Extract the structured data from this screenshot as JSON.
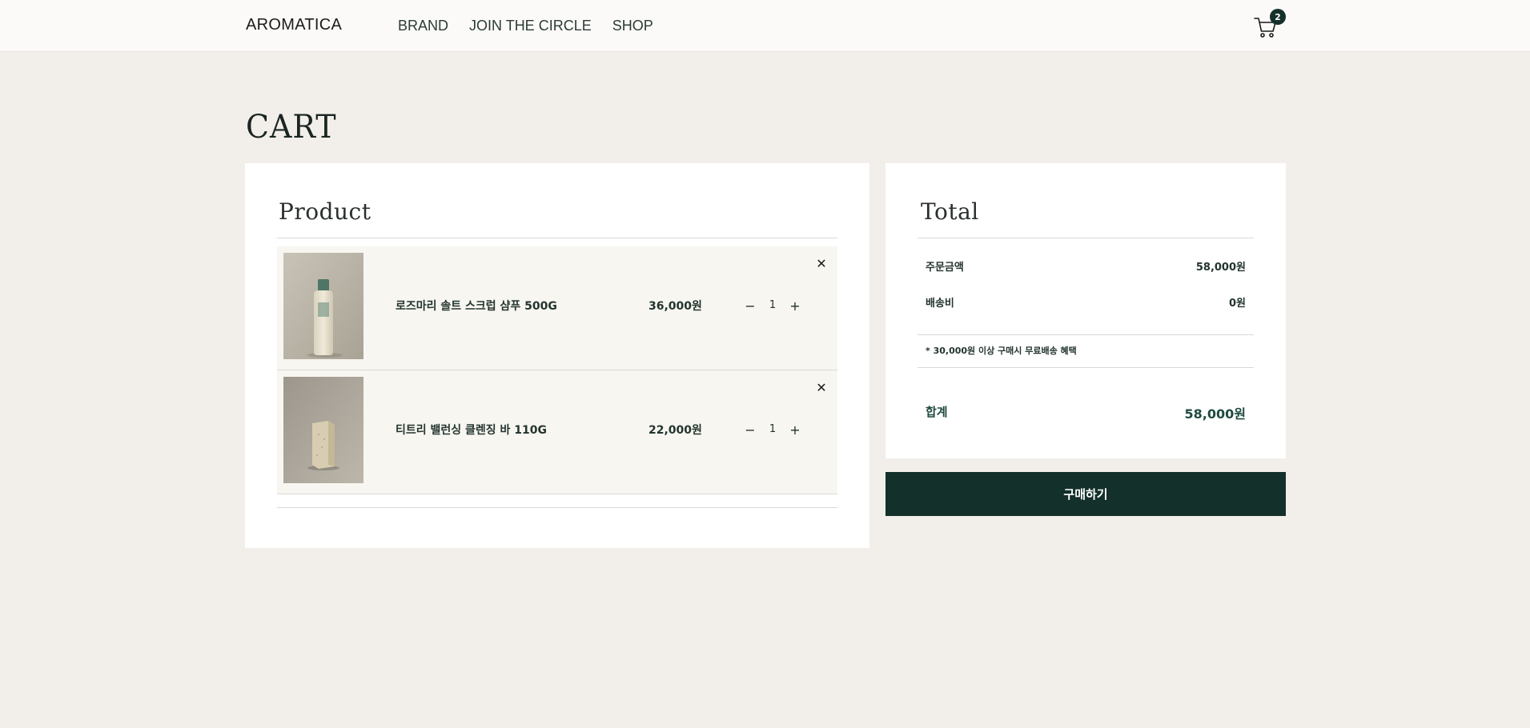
{
  "header": {
    "logo": "AROMATICA",
    "nav": [
      {
        "label": "BRAND"
      },
      {
        "label": "JOIN THE CIRCLE"
      },
      {
        "label": "SHOP"
      }
    ],
    "cart_icon": "cart-icon",
    "cart_count": "2"
  },
  "page": {
    "title": "CART"
  },
  "product_panel": {
    "heading": "Product",
    "items": [
      {
        "name": "로즈마리 솔트 스크럽 샴푸 500G",
        "price": "36,000원",
        "quantity": "1",
        "minus": "−",
        "plus": "+",
        "remove": "✕",
        "image": "shampoo-bottle-image"
      },
      {
        "name": "티트리 밸런싱 클렌징 바 110G",
        "price": "22,000원",
        "quantity": "1",
        "minus": "−",
        "plus": "+",
        "remove": "✕",
        "image": "cleansing-bar-image"
      }
    ]
  },
  "total_panel": {
    "heading": "Total",
    "order_amount_label": "주문금액",
    "order_amount_value": "58,000원",
    "shipping_label": "배송비",
    "shipping_value": "0원",
    "note": "* 30,000원 이상 구매시 무료배송 혜택",
    "total_label": "합계",
    "total_value": "58,000원"
  },
  "buy_button": {
    "label": "구매하기"
  },
  "colors": {
    "page_bg": "#f2efea",
    "accent_dark_green": "#13302a",
    "row_bg": "#f8f6f1"
  }
}
